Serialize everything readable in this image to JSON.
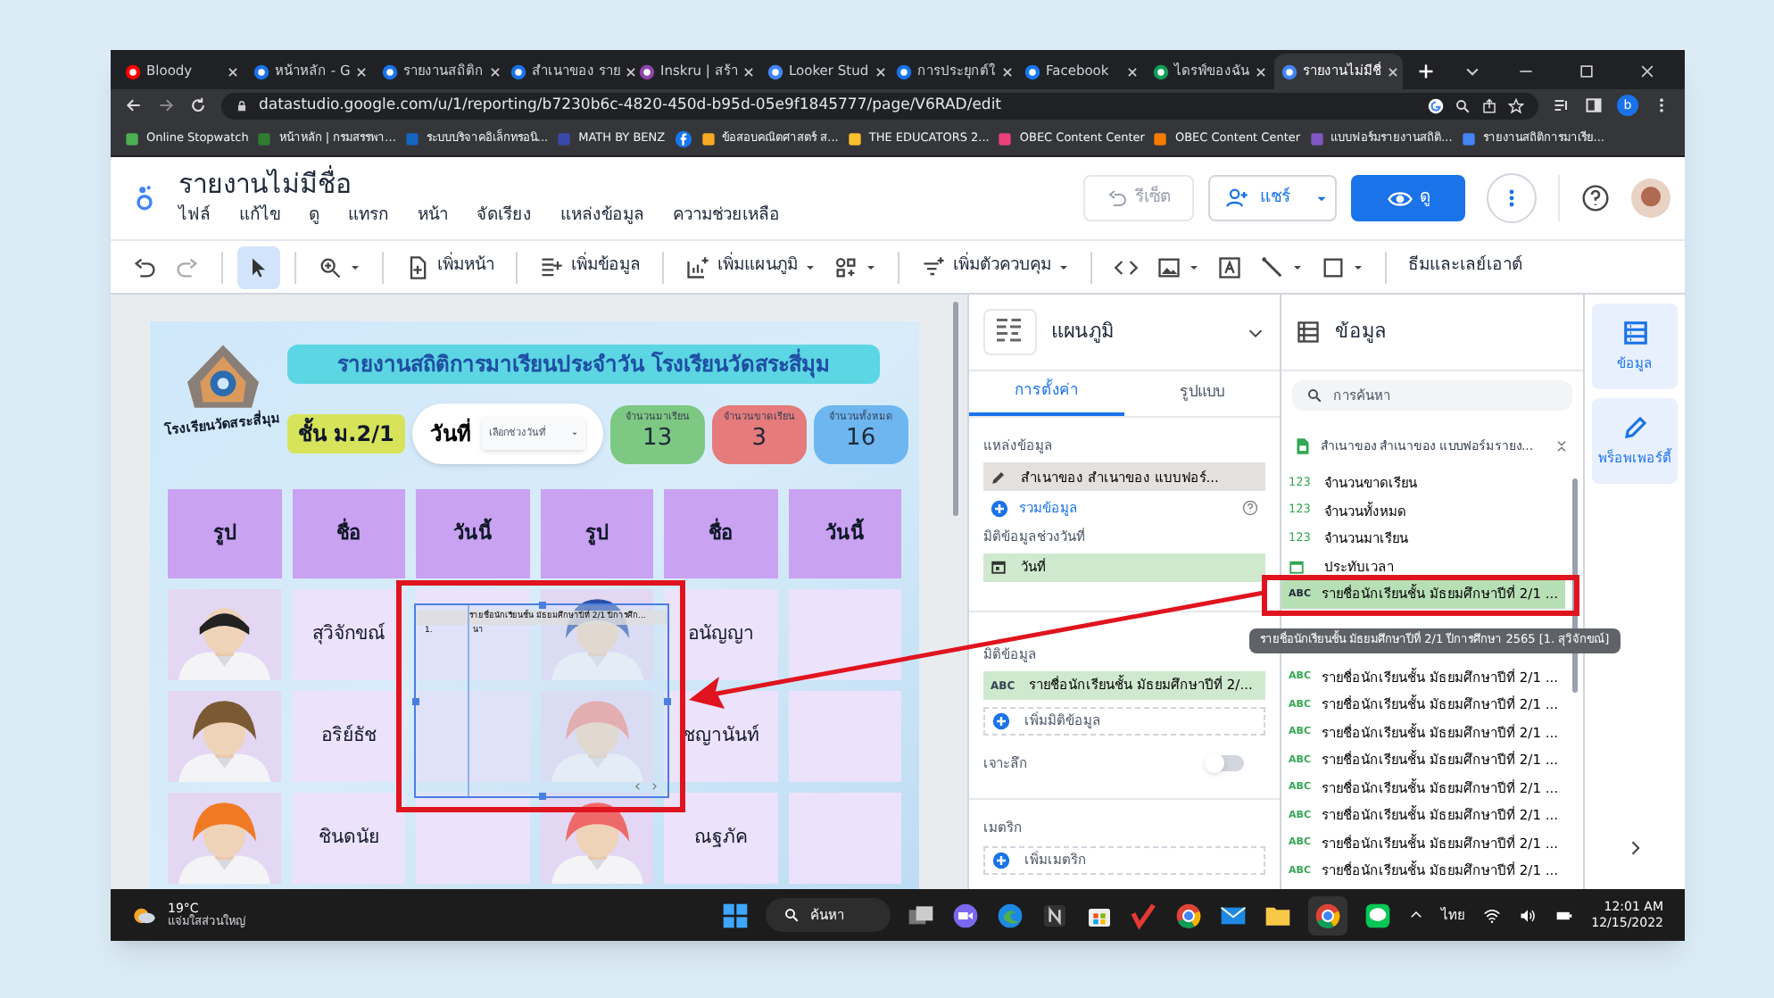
{
  "browser": {
    "tabs": [
      {
        "label": "Bloody",
        "selected": false
      },
      {
        "label": "หน้าหลัก - G",
        "selected": false
      },
      {
        "label": "รายงานสถิติก",
        "selected": false
      },
      {
        "label": "สำเนาของ ราย",
        "selected": false
      },
      {
        "label": "Inskru | สร้า",
        "selected": false
      },
      {
        "label": "Looker Stud",
        "selected": false
      },
      {
        "label": "การประยุกต์ใ",
        "selected": false
      },
      {
        "label": "Facebook",
        "selected": false
      },
      {
        "label": "ไดรฟ์ของฉัน",
        "selected": false
      },
      {
        "label": "รายงานไม่มีชื่",
        "selected": true
      }
    ],
    "url": "datastudio.google.com/u/1/reporting/b7230b6c-4820-450d-b95d-05e9f1845777/page/V6RAD/edit",
    "profile": "b",
    "bookmarks": [
      "Online Stopwatch",
      "หน้าหลัก | กรมสรรพา...",
      "ระบบบริจาคอิเล็กทรอนิ...",
      "MATH BY BENZ",
      "ข้อสอบคณิตศาสตร์ ส...",
      "THE EDUCATORS 2...",
      "OBEC Content Center",
      "OBEC Content Center",
      "แบบฟอร์มรายงานสถิติ...",
      "รายงานสถิติการมาเรีย..."
    ]
  },
  "app": {
    "title": "รายงานไม่มีชื่อ",
    "menu": [
      "ไฟล์",
      "แก้ไข",
      "ดู",
      "แทรก",
      "หน้า",
      "จัดเรียง",
      "แหล่งข้อมูล",
      "ความช่วยเหลือ"
    ],
    "reset": {
      "label": "รีเซ็ต",
      "disabled": true
    },
    "share": "แชร์",
    "view": "ดู"
  },
  "toolbar": {
    "select_active": true,
    "add_page": "เพิ่มหน้า",
    "add_data": "เพิ่มข้อมูล",
    "add_chart": "เพิ่มแผนภูมิ",
    "add_control": "เพิ่มตัวควบคุม",
    "theme": "ธีมและเลย์เอาต์"
  },
  "report": {
    "title": "รายงานสถิติการมาเรียนประจำวัน โรงเรียนวัดสระสี่มุม",
    "school": "โรงเรียนวัดสระสี่มุม",
    "class": "ชั้น ม.2/1",
    "date_label": "วันที่",
    "date_picker": "เลือกช่วงวันที่",
    "cards": [
      {
        "label": "จำนวนมาเรียน",
        "value": "13",
        "color": "#7dc882"
      },
      {
        "label": "จำนวนขาดเรียน",
        "value": "3",
        "color": "#e57b7b"
      },
      {
        "label": "จำนวนทั้งหมด",
        "value": "16",
        "color": "#6db6f0"
      }
    ],
    "columns": [
      "รูป",
      "ชื่อ",
      "วันนี้",
      "รูป",
      "ชื่อ",
      "วันนี้"
    ],
    "rows": [
      {
        "left": "สุวิจักขณ์",
        "right": "อนัญญา"
      },
      {
        "left": "อริย์ธัช",
        "right": "ชญานันท์"
      },
      {
        "left": "ชินดนัย",
        "right": "ณฐภัค"
      }
    ],
    "selected_table": {
      "header": "รายชื่อนักเรียนชั้น มัธยมศึกษาปีที่ 2/1 ปีการศึก...",
      "cells": [
        "1.",
        "นา"
      ]
    }
  },
  "properties": {
    "chart_type": "แผนภูมิ",
    "tabs": [
      {
        "label": "การตั้งค่า",
        "selected": true
      },
      {
        "label": "รูปแบบ",
        "selected": false
      }
    ],
    "data_source_label": "แหล่งข้อมูล",
    "data_source": "สำเนาของ สำเนาของ แบบฟอร์...",
    "blend": "รวมข้อมูล",
    "date_range_label": "มิติข้อมูลช่วงวันที่",
    "date_range": "วันที่",
    "dimension_label": "มิติข้อมูล",
    "dimension_type": "ABC",
    "dimension": "รายชื่อนักเรียนชั้น มัธยมศึกษาปีที่ 2/...",
    "add_dimension": "เพิ่มมิติข้อมูล",
    "drill_down": {
      "label": "เจาะลึก",
      "on": false
    },
    "metric_label": "เมตริก",
    "add_metric": "เพิ่มเมตริก"
  },
  "data_panel": {
    "title": "ข้อมูล",
    "search_placeholder": "การค้นหา",
    "source": "สำเนาของ สำเนาของ แบบฟอร์มรายง...",
    "fields": [
      {
        "kind": "number",
        "type_label": "123",
        "label": "จำนวนขาดเรียน",
        "selected": false
      },
      {
        "kind": "number",
        "type_label": "123",
        "label": "จำนวนทั้งหมด",
        "selected": false
      },
      {
        "kind": "number",
        "type_label": "123",
        "label": "จำนวนมาเรียน",
        "selected": false
      },
      {
        "kind": "date",
        "label": "ประทับเวลา",
        "selected": false
      },
      {
        "kind": "text",
        "type_label": "ABC",
        "label": "รายชื่อนักเรียนชั้น มัธยมศึกษาปีที่ 2/1 ...",
        "selected": true
      },
      {
        "kind": "text",
        "type_label": "ABC",
        "label": "รายชื่อนักเรียนชั้น มัธยมศึกษาปีที่ 2/1 ...",
        "selected": false
      },
      {
        "kind": "text",
        "type_label": "ABC",
        "label": "รายชื่อนักเรียนชั้น มัธยมศึกษาปีที่ 2/1 ...",
        "selected": false
      },
      {
        "kind": "text",
        "type_label": "ABC",
        "label": "รายชื่อนักเรียนชั้น มัธยมศึกษาปีที่ 2/1 ...",
        "selected": false
      },
      {
        "kind": "text",
        "type_label": "ABC",
        "label": "รายชื่อนักเรียนชั้น มัธยมศึกษาปีที่ 2/1 ...",
        "selected": false
      },
      {
        "kind": "text",
        "type_label": "ABC",
        "label": "รายชื่อนักเรียนชั้น มัธยมศึกษาปีที่ 2/1 ...",
        "selected": false
      },
      {
        "kind": "text",
        "type_label": "ABC",
        "label": "รายชื่อนักเรียนชั้น มัธยมศึกษาปีที่ 2/1 ...",
        "selected": false
      },
      {
        "kind": "text",
        "type_label": "ABC",
        "label": "รายชื่อนักเรียนชั้น มัธยมศึกษาปีที่ 2/1 ...",
        "selected": false
      },
      {
        "kind": "text",
        "type_label": "ABC",
        "label": "รายชื่อนักเรียนชั้น มัธยมศึกษาปีที่ 2/1 ...",
        "selected": false
      }
    ],
    "tooltip": "รายชื่อนักเรียนชั้น มัธยมศึกษาปีที่ 2/1 ปีการศึกษา 2565 [1. สุวิจักขณ์]"
  },
  "rail": [
    "ข้อมูล",
    "พร็อพเพอร์ตี้"
  ],
  "taskbar": {
    "temperature": "19°C",
    "weather": "แจ่มใสส่วนใหญ่",
    "search": "ค้นหา",
    "language": "ไทย",
    "time": "12:01 AM",
    "date": "12/15/2022"
  }
}
